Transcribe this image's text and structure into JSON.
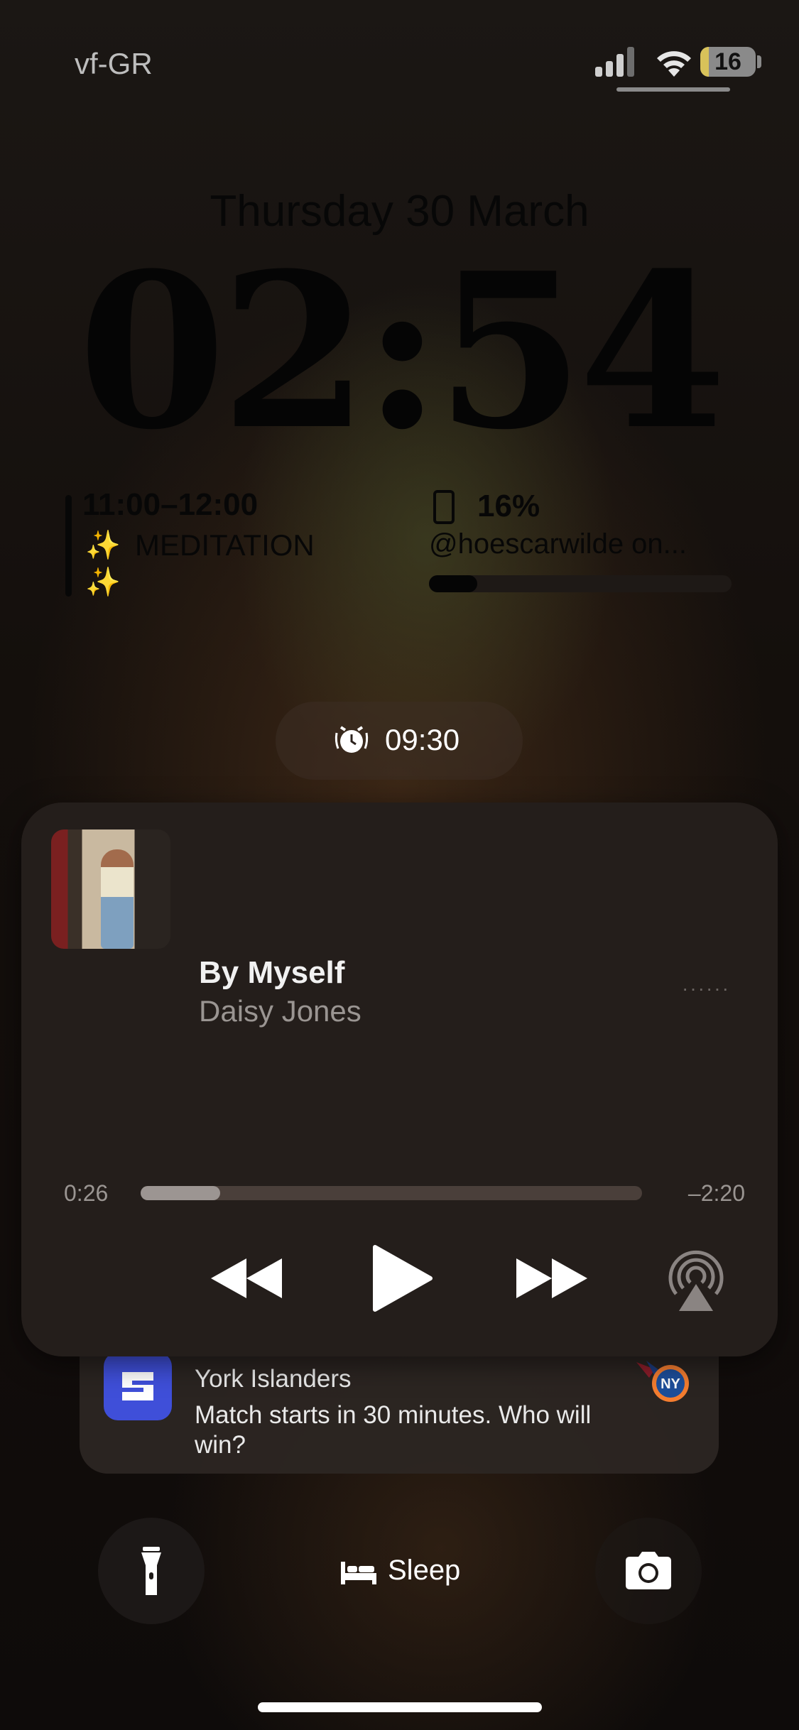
{
  "status_bar": {
    "carrier": "vf-GR",
    "battery_level": "16",
    "battery_fraction": 0.16
  },
  "lock": {
    "date": "Thursday 30 March",
    "time": "02:54"
  },
  "widgets": {
    "calendar": {
      "time_range": "11:00–12:00",
      "sparkles": "✨",
      "title": "MEDITATION"
    },
    "battery": {
      "percent": "16%",
      "device_name": "@hoescarwilde on...",
      "level_fraction": 0.16
    }
  },
  "alarm": {
    "icon": "alarm-clock-icon",
    "time": "09:30"
  },
  "now_playing": {
    "song": "By Myself",
    "artist": "Daisy Jones",
    "more_dots": "······",
    "elapsed": "0:26",
    "remaining": "–2:20",
    "progress_fraction": 0.158,
    "controls": [
      "rewind-icon",
      "play-icon",
      "fast-forward-icon",
      "airplay-icon"
    ]
  },
  "notification": {
    "line1": "York Islanders",
    "line2": "Match starts in 30 minutes. Who will win?",
    "app_icon": "sofascore-app-icon",
    "team_icon": "ny-islanders-logo",
    "accent": "#3f4fd9"
  },
  "bottom": {
    "sleep_label": "Sleep",
    "flashlight_icon": "flashlight-icon",
    "camera_icon": "camera-icon"
  }
}
